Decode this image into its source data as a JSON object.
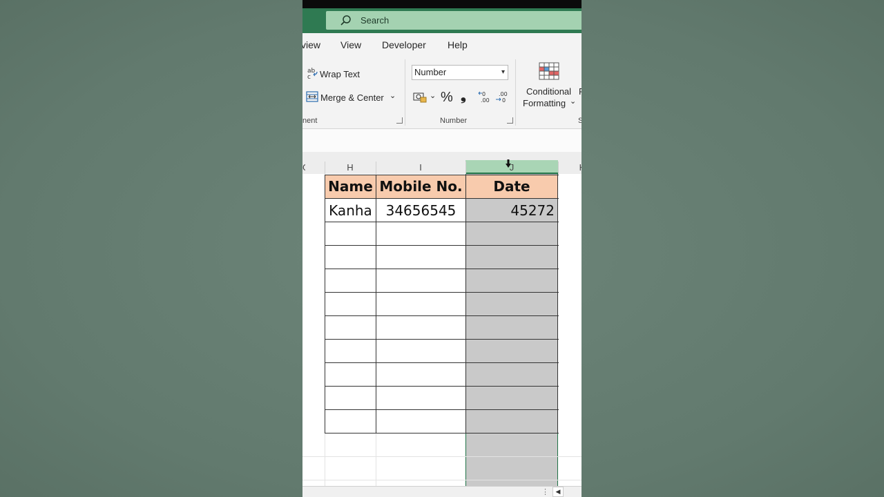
{
  "search": {
    "placeholder": "Search"
  },
  "menu": {
    "items": [
      "view",
      "View",
      "Developer",
      "Help"
    ]
  },
  "ribbon": {
    "wrap_text": "Wrap Text",
    "merge_center": "Merge & Center",
    "alignment_group": "nent",
    "number_format": "Number",
    "percent_symbol": "%",
    "comma_symbol": "❟",
    "number_group": "Number",
    "conditional_line1": "Conditional",
    "conditional_line2": "Formatting",
    "styles_cut": "S",
    "format_cut": "F"
  },
  "columns": {
    "prev": "G",
    "h": "H",
    "i": "I",
    "j": "J",
    "k": "K"
  },
  "table": {
    "headers": [
      "Name",
      "Mobile No.",
      "Date"
    ],
    "row1": [
      "Kanha",
      "34656545",
      "45272"
    ]
  },
  "colors": {
    "header_fill": "#f8cbad",
    "selection": "#c9c9c9",
    "accent": "#1e7145"
  }
}
